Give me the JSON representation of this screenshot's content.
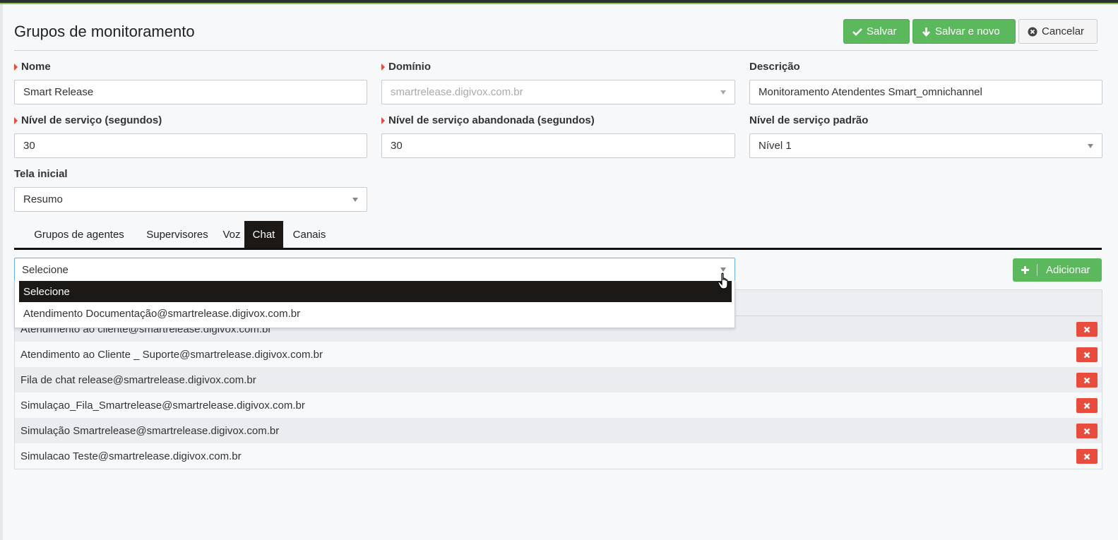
{
  "header": {
    "title": "Grupos de monitoramento",
    "save_label": "Salvar",
    "save_new_label": "Salvar e novo",
    "cancel_label": "Cancelar"
  },
  "form": {
    "nome": {
      "label": "Nome",
      "value": "Smart Release"
    },
    "dominio": {
      "label": "Domínio",
      "value": "smartrelease.digivox.com.br"
    },
    "descricao": {
      "label": "Descrição",
      "value": "Monitoramento Atendentes Smart_omnichannel"
    },
    "nivel_servico": {
      "label": "Nível de serviço (segundos)",
      "value": "30"
    },
    "nivel_abandonada": {
      "label": "Nível de serviço abandonada (segundos)",
      "value": "30"
    },
    "nivel_padrao": {
      "label": "Nível de serviço padrão",
      "value": "Nível 1"
    },
    "tela_inicial": {
      "label": "Tela inicial",
      "value": "Resumo"
    }
  },
  "tabs": [
    {
      "label": "Grupos de agentes"
    },
    {
      "label": "Supervisores"
    },
    {
      "label": "Voz"
    },
    {
      "label": "Chat"
    },
    {
      "label": "Canais"
    }
  ],
  "chat": {
    "select_value": "Selecione",
    "dropdown_options": [
      "Selecione",
      "Atendimento Documentação@smartrelease.digivox.com.br"
    ],
    "add_label": "Adicionar",
    "rows": [
      "Atendimento ao cliente@smartrelease.digivox.com.br",
      "Atendimento ao Cliente _ Suporte@smartrelease.digivox.com.br",
      "Fila de chat release@smartrelease.digivox.com.br",
      "Simulaçao_Fila_Smartrelease@smartrelease.digivox.com.br",
      "Simulação Smartrelease@smartrelease.digivox.com.br",
      "Simulacao Teste@smartrelease.digivox.com.br"
    ]
  },
  "colors": {
    "green": "#5cb85c",
    "red": "#e74c3c",
    "active_tab": "#1c1815"
  }
}
